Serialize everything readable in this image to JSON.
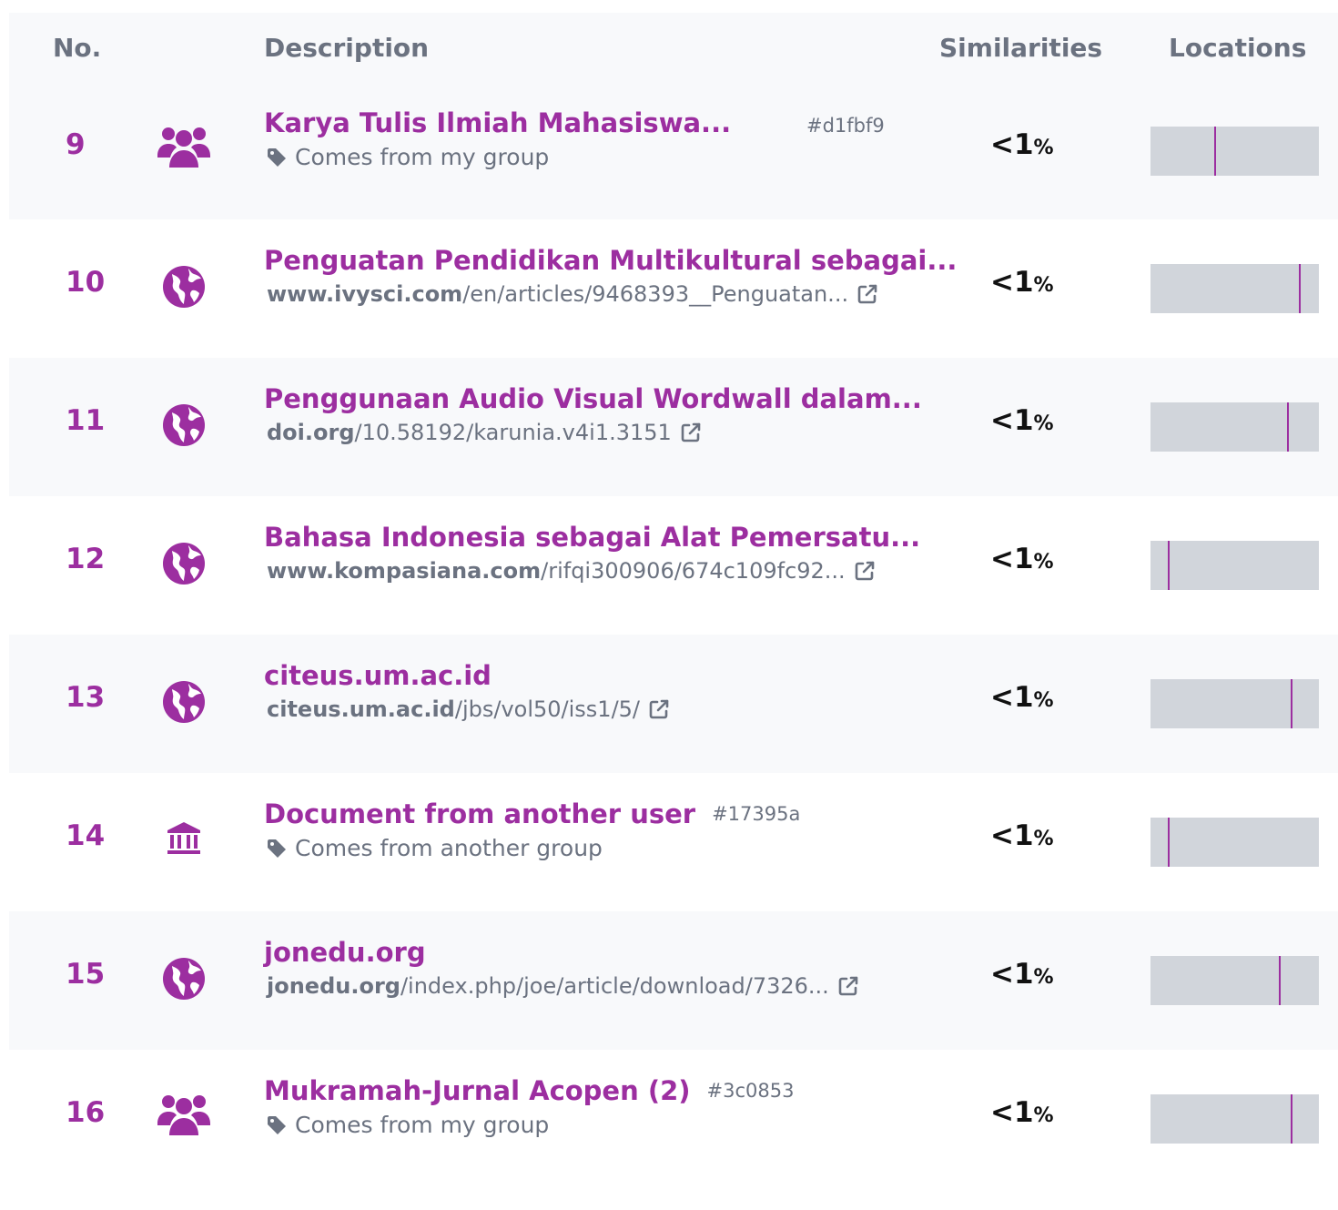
{
  "header": {
    "no": "No.",
    "description": "Description",
    "similarities": "Similarities",
    "locations": "Locations"
  },
  "colors": {
    "accent": "#9c2ea0",
    "muted": "#6b7280",
    "bar": "#d1d5db",
    "row_shade": "#f8f9fb"
  },
  "rows": [
    {
      "no": "9",
      "icon": "group-icon",
      "title": "Karya Tulis Ilmiah Mahasiswa...",
      "hash": "#d1fbf9",
      "subtitle": "Comes from my group",
      "similarity": "<1",
      "percent_sign": "%",
      "location_markers": [
        0.38
      ]
    },
    {
      "no": "10",
      "icon": "globe-icon",
      "title": "Penguatan Pendidikan Multikultural sebagai...",
      "url_domain": "www.ivysci.com",
      "url_path": "/en/articles/9468393__Penguatan...",
      "similarity": "<1",
      "percent_sign": "%",
      "location_markers": [
        0.88
      ]
    },
    {
      "no": "11",
      "icon": "globe-icon",
      "title": "Penggunaan Audio Visual Wordwall dalam...",
      "url_domain": "doi.org",
      "url_path": "/10.58192/karunia.v4i1.3151",
      "similarity": "<1",
      "percent_sign": "%",
      "location_markers": [
        0.81
      ]
    },
    {
      "no": "12",
      "icon": "globe-icon",
      "title": "Bahasa Indonesia sebagai Alat Pemersatu...",
      "url_domain": "www.kompasiana.com",
      "url_path": "/rifqi300906/674c109fc92...",
      "similarity": "<1",
      "percent_sign": "%",
      "location_markers": [
        0.1
      ]
    },
    {
      "no": "13",
      "icon": "globe-icon",
      "title": "citeus.um.ac.id",
      "url_domain": "citeus.um.ac.id",
      "url_path": "/jbs/vol50/iss1/5/",
      "similarity": "<1",
      "percent_sign": "%",
      "location_markers": [
        0.83
      ]
    },
    {
      "no": "14",
      "icon": "institution-icon",
      "title": "Document from another user",
      "hash": "#17395a",
      "subtitle": "Comes from another group",
      "similarity": "<1",
      "percent_sign": "%",
      "location_markers": [
        0.1
      ]
    },
    {
      "no": "15",
      "icon": "globe-icon",
      "title": "jonedu.org",
      "url_domain": "jonedu.org",
      "url_path": "/index.php/joe/article/download/7326...",
      "similarity": "<1",
      "percent_sign": "%",
      "location_markers": [
        0.76
      ]
    },
    {
      "no": "16",
      "icon": "group-icon",
      "title": "Mukramah-Jurnal Acopen (2)",
      "hash": "#3c0853",
      "subtitle": "Comes from my group",
      "similarity": "<1",
      "percent_sign": "%",
      "location_markers": [
        0.83
      ]
    }
  ]
}
